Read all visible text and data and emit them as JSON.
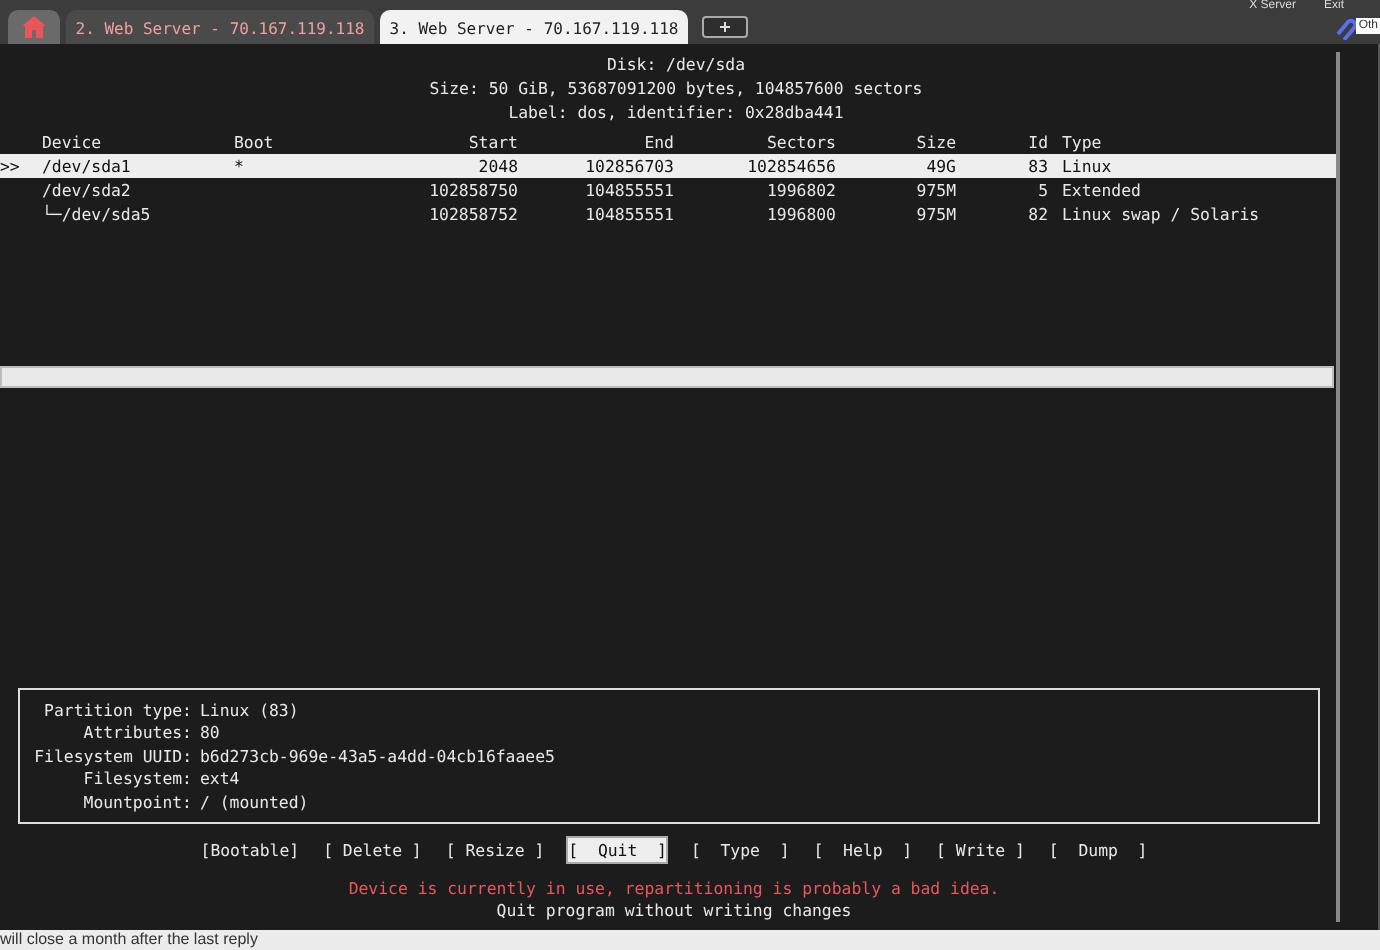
{
  "tabs": [
    {
      "kind": "home",
      "selected": false
    },
    {
      "kind": "page",
      "label": "2. Web Server - 70.167.119.118",
      "selected": false
    },
    {
      "kind": "page",
      "label": "3. Web Server - 70.167.119.118",
      "selected": true
    },
    {
      "kind": "new",
      "selected": false
    }
  ],
  "top_right": [
    "X Server",
    "Exit",
    "Oth"
  ],
  "disk": {
    "lines": [
      "Disk: /dev/sda",
      "Size: 50 GiB, 53687091200 bytes, 104857600 sectors",
      "Label: dos, identifier: 0x28dba441"
    ]
  },
  "table": {
    "columns": [
      "Device",
      "Boot",
      "Start",
      "End",
      "Sectors",
      "Size",
      "Id",
      "Type"
    ],
    "rows": [
      {
        "marker": ">>",
        "device": "/dev/sda1",
        "boot": "*",
        "start": "2048",
        "end": "102856703",
        "sectors": "102854656",
        "size": "49G",
        "id": "83",
        "type": "Linux",
        "selected": true
      },
      {
        "device": "/dev/sda2",
        "start": "102858750",
        "end": "104855551",
        "sectors": "1996802",
        "size": "975M",
        "id": "5",
        "type": "Extended",
        "selected": false,
        "children": [
          {
            "device": "└─/dev/sda5",
            "start": "102858752",
            "end": "104855551",
            "sectors": "1996800",
            "size": "975M",
            "id": "82",
            "type": "Linux swap / Solaris",
            "selected": false
          }
        ]
      }
    ]
  },
  "info": [
    {
      "label": "Partition type:",
      "value": "Linux (83)"
    },
    {
      "label": "Attributes:",
      "value": "80"
    },
    {
      "label": "Filesystem UUID:",
      "value": "b6d273cb-969e-43a5-a4dd-04cb16faaee5"
    },
    {
      "label": "Filesystem:",
      "value": "ext4"
    },
    {
      "label": "Mountpoint:",
      "value": "/ (mounted)"
    }
  ],
  "menu": [
    {
      "label": "[Bootable]",
      "selected": false
    },
    {
      "label": "[ Delete ]",
      "selected": false
    },
    {
      "label": "[ Resize ]",
      "selected": false
    },
    {
      "label": "[  Quit  ]",
      "selected": true
    },
    {
      "label": "[  Type  ]",
      "selected": false
    },
    {
      "label": "[  Help  ]",
      "selected": false
    },
    {
      "label": "[ Write ]",
      "selected": false
    },
    {
      "label": "[  Dump  ]",
      "selected": false
    }
  ],
  "warning": "Device is currently in use, repartitioning is probably a bad idea.",
  "hint": "Quit program without writing changes",
  "footer": "will close a month after the last reply"
}
